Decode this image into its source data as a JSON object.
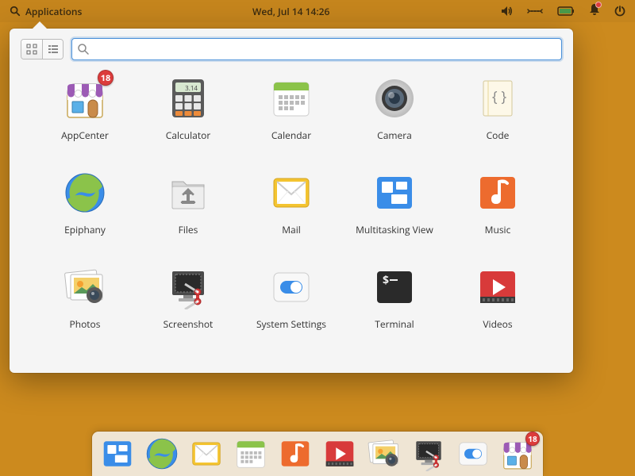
{
  "topbar": {
    "apps_label": "Applications",
    "datetime": "Wed, Jul 14    14:26"
  },
  "search": {
    "placeholder": ""
  },
  "badge_count": "18",
  "apps": [
    {
      "id": "appcenter",
      "label": "AppCenter",
      "badge": "18"
    },
    {
      "id": "calculator",
      "label": "Calculator"
    },
    {
      "id": "calendar",
      "label": "Calendar"
    },
    {
      "id": "camera",
      "label": "Camera"
    },
    {
      "id": "code",
      "label": "Code"
    },
    {
      "id": "epiphany",
      "label": "Epiphany"
    },
    {
      "id": "files",
      "label": "Files"
    },
    {
      "id": "mail",
      "label": "Mail"
    },
    {
      "id": "multitasking",
      "label": "Multitasking View"
    },
    {
      "id": "music",
      "label": "Music"
    },
    {
      "id": "photos",
      "label": "Photos"
    },
    {
      "id": "screenshot",
      "label": "Screenshot"
    },
    {
      "id": "settings",
      "label": "System Settings"
    },
    {
      "id": "terminal",
      "label": "Terminal"
    },
    {
      "id": "videos",
      "label": "Videos"
    }
  ],
  "dock": [
    "multitasking",
    "epiphany",
    "mail",
    "calendar",
    "music",
    "videos",
    "photos",
    "screenshot",
    "settings",
    "appcenter"
  ]
}
